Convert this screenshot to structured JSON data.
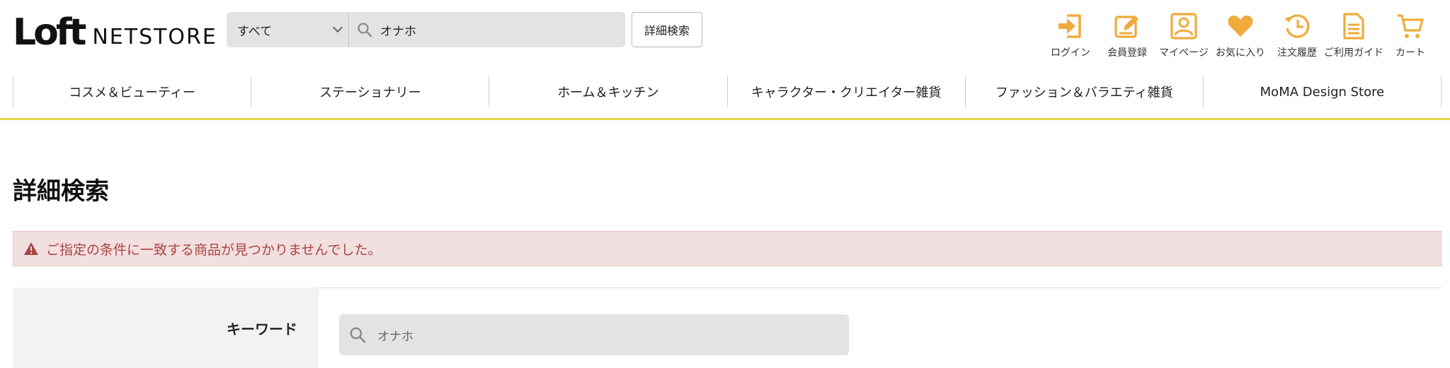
{
  "header": {
    "logo_mark": "Loft",
    "logo_text": "NETSTORE",
    "search": {
      "scope_value": "すべて",
      "query": "オナホ"
    },
    "advanced_search_label": "詳細検索",
    "util_nav": [
      {
        "label": "ログイン",
        "icon": "login-icon"
      },
      {
        "label": "会員登録",
        "icon": "register-icon"
      },
      {
        "label": "マイページ",
        "icon": "mypage-icon"
      },
      {
        "label": "お気に入り",
        "icon": "heart-icon"
      },
      {
        "label": "注文履歴",
        "icon": "history-icon"
      },
      {
        "label": "ご利用ガイド",
        "icon": "guide-icon"
      },
      {
        "label": "カート",
        "icon": "cart-icon"
      }
    ]
  },
  "category_nav": [
    "コスメ＆ビューティー",
    "ステーショナリー",
    "ホーム＆キッチン",
    "キャラクター・クリエイター雑貨",
    "ファッション＆バラエティ雑貨",
    "MoMA Design Store"
  ],
  "page_title": "詳細検索",
  "alert_message": "ご指定の条件に一致する商品が見つかりませんでした。",
  "form": {
    "keyword_label": "キーワード",
    "keyword_value": "オナホ"
  },
  "colors": {
    "accent": "#f0ab3c",
    "nav_underline": "#e8d84a",
    "alert_bg": "#f2dfe0",
    "alert_text": "#a94442"
  }
}
